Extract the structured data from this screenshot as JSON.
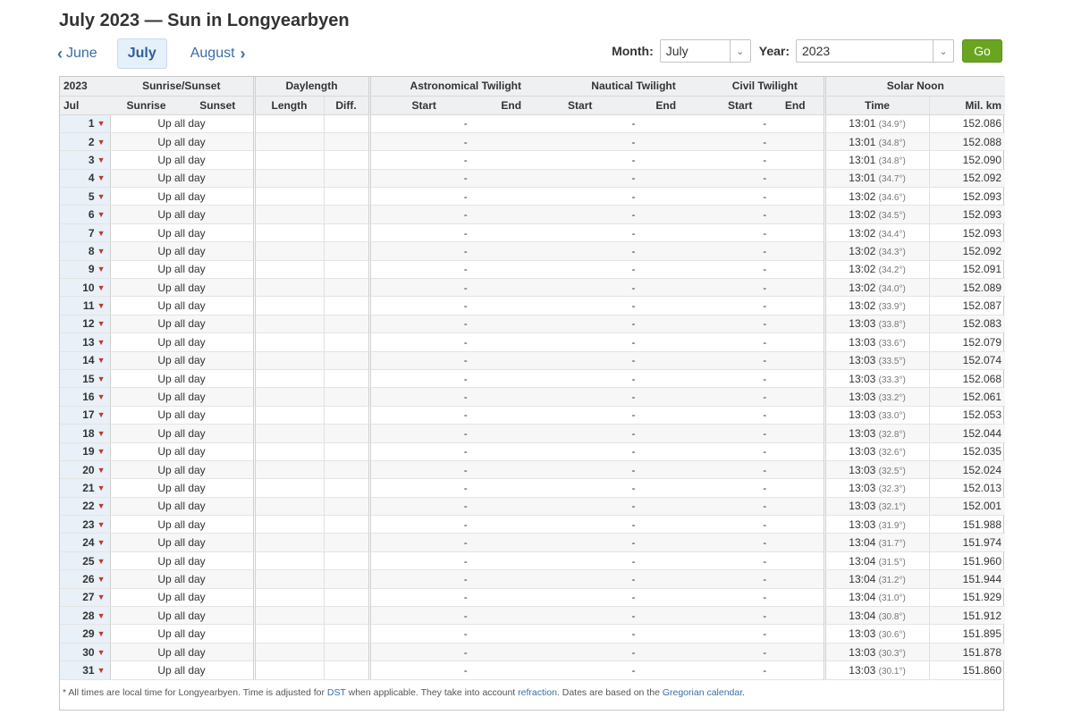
{
  "title": "July 2023 — Sun in Longyearbyen",
  "nav": {
    "prev": "June",
    "current": "July",
    "next": "August"
  },
  "picker": {
    "month_label": "Month:",
    "month_value": "July",
    "year_label": "Year:",
    "year_value": "2023",
    "go_label": "Go"
  },
  "table": {
    "groups": {
      "year": "2023",
      "sunrise_sunset": "Sunrise/Sunset",
      "daylength": "Daylength",
      "astro": "Astronomical Twilight",
      "nautical": "Nautical Twilight",
      "civil": "Civil Twilight",
      "noon": "Solar Noon"
    },
    "cols": {
      "month": "Jul",
      "sunrise": "Sunrise",
      "sunset": "Sunset",
      "length": "Length",
      "diff": "Diff.",
      "astro_start": "Start",
      "astro_end": "End",
      "naut_start": "Start",
      "naut_end": "End",
      "civil_start": "Start",
      "civil_end": "End",
      "time": "Time",
      "km": "Mil. km"
    },
    "rows": [
      {
        "day": "1",
        "status": "Up all day",
        "astro": "-",
        "naut": "-",
        "civil": "-",
        "time": "13:01",
        "angle": "(34.9°)",
        "km": "152.086"
      },
      {
        "day": "2",
        "status": "Up all day",
        "astro": "-",
        "naut": "-",
        "civil": "-",
        "time": "13:01",
        "angle": "(34.8°)",
        "km": "152.088"
      },
      {
        "day": "3",
        "status": "Up all day",
        "astro": "-",
        "naut": "-",
        "civil": "-",
        "time": "13:01",
        "angle": "(34.8°)",
        "km": "152.090"
      },
      {
        "day": "4",
        "status": "Up all day",
        "astro": "-",
        "naut": "-",
        "civil": "-",
        "time": "13:01",
        "angle": "(34.7°)",
        "km": "152.092"
      },
      {
        "day": "5",
        "status": "Up all day",
        "astro": "-",
        "naut": "-",
        "civil": "-",
        "time": "13:02",
        "angle": "(34.6°)",
        "km": "152.093"
      },
      {
        "day": "6",
        "status": "Up all day",
        "astro": "-",
        "naut": "-",
        "civil": "-",
        "time": "13:02",
        "angle": "(34.5°)",
        "km": "152.093"
      },
      {
        "day": "7",
        "status": "Up all day",
        "astro": "-",
        "naut": "-",
        "civil": "-",
        "time": "13:02",
        "angle": "(34.4°)",
        "km": "152.093"
      },
      {
        "day": "8",
        "status": "Up all day",
        "astro": "-",
        "naut": "-",
        "civil": "-",
        "time": "13:02",
        "angle": "(34.3°)",
        "km": "152.092"
      },
      {
        "day": "9",
        "status": "Up all day",
        "astro": "-",
        "naut": "-",
        "civil": "-",
        "time": "13:02",
        "angle": "(34.2°)",
        "km": "152.091"
      },
      {
        "day": "10",
        "status": "Up all day",
        "astro": "-",
        "naut": "-",
        "civil": "-",
        "time": "13:02",
        "angle": "(34.0°)",
        "km": "152.089"
      },
      {
        "day": "11",
        "status": "Up all day",
        "astro": "-",
        "naut": "-",
        "civil": "-",
        "time": "13:02",
        "angle": "(33.9°)",
        "km": "152.087"
      },
      {
        "day": "12",
        "status": "Up all day",
        "astro": "-",
        "naut": "-",
        "civil": "-",
        "time": "13:03",
        "angle": "(33.8°)",
        "km": "152.083"
      },
      {
        "day": "13",
        "status": "Up all day",
        "astro": "-",
        "naut": "-",
        "civil": "-",
        "time": "13:03",
        "angle": "(33.6°)",
        "km": "152.079"
      },
      {
        "day": "14",
        "status": "Up all day",
        "astro": "-",
        "naut": "-",
        "civil": "-",
        "time": "13:03",
        "angle": "(33.5°)",
        "km": "152.074"
      },
      {
        "day": "15",
        "status": "Up all day",
        "astro": "-",
        "naut": "-",
        "civil": "-",
        "time": "13:03",
        "angle": "(33.3°)",
        "km": "152.068"
      },
      {
        "day": "16",
        "status": "Up all day",
        "astro": "-",
        "naut": "-",
        "civil": "-",
        "time": "13:03",
        "angle": "(33.2°)",
        "km": "152.061"
      },
      {
        "day": "17",
        "status": "Up all day",
        "astro": "-",
        "naut": "-",
        "civil": "-",
        "time": "13:03",
        "angle": "(33.0°)",
        "km": "152.053"
      },
      {
        "day": "18",
        "status": "Up all day",
        "astro": "-",
        "naut": "-",
        "civil": "-",
        "time": "13:03",
        "angle": "(32.8°)",
        "km": "152.044"
      },
      {
        "day": "19",
        "status": "Up all day",
        "astro": "-",
        "naut": "-",
        "civil": "-",
        "time": "13:03",
        "angle": "(32.6°)",
        "km": "152.035"
      },
      {
        "day": "20",
        "status": "Up all day",
        "astro": "-",
        "naut": "-",
        "civil": "-",
        "time": "13:03",
        "angle": "(32.5°)",
        "km": "152.024"
      },
      {
        "day": "21",
        "status": "Up all day",
        "astro": "-",
        "naut": "-",
        "civil": "-",
        "time": "13:03",
        "angle": "(32.3°)",
        "km": "152.013"
      },
      {
        "day": "22",
        "status": "Up all day",
        "astro": "-",
        "naut": "-",
        "civil": "-",
        "time": "13:03",
        "angle": "(32.1°)",
        "km": "152.001"
      },
      {
        "day": "23",
        "status": "Up all day",
        "astro": "-",
        "naut": "-",
        "civil": "-",
        "time": "13:03",
        "angle": "(31.9°)",
        "km": "151.988"
      },
      {
        "day": "24",
        "status": "Up all day",
        "astro": "-",
        "naut": "-",
        "civil": "-",
        "time": "13:04",
        "angle": "(31.7°)",
        "km": "151.974"
      },
      {
        "day": "25",
        "status": "Up all day",
        "astro": "-",
        "naut": "-",
        "civil": "-",
        "time": "13:04",
        "angle": "(31.5°)",
        "km": "151.960"
      },
      {
        "day": "26",
        "status": "Up all day",
        "astro": "-",
        "naut": "-",
        "civil": "-",
        "time": "13:04",
        "angle": "(31.2°)",
        "km": "151.944"
      },
      {
        "day": "27",
        "status": "Up all day",
        "astro": "-",
        "naut": "-",
        "civil": "-",
        "time": "13:04",
        "angle": "(31.0°)",
        "km": "151.929"
      },
      {
        "day": "28",
        "status": "Up all day",
        "astro": "-",
        "naut": "-",
        "civil": "-",
        "time": "13:04",
        "angle": "(30.8°)",
        "km": "151.912"
      },
      {
        "day": "29",
        "status": "Up all day",
        "astro": "-",
        "naut": "-",
        "civil": "-",
        "time": "13:03",
        "angle": "(30.6°)",
        "km": "151.895"
      },
      {
        "day": "30",
        "status": "Up all day",
        "astro": "-",
        "naut": "-",
        "civil": "-",
        "time": "13:03",
        "angle": "(30.3°)",
        "km": "151.878"
      },
      {
        "day": "31",
        "status": "Up all day",
        "astro": "-",
        "naut": "-",
        "civil": "-",
        "time": "13:03",
        "angle": "(30.1°)",
        "km": "151.860"
      }
    ]
  },
  "footnote": {
    "part1": "* All times are local time for Longyearbyen. Time is adjusted for ",
    "dst": "DST",
    "part2": " when applicable. They take into account ",
    "refraction": "refraction",
    "part3": ". Dates are based on the ",
    "gregorian": "Gregorian calendar",
    "part4": "."
  },
  "icons": {
    "prev": "chevron-left-icon",
    "next": "chevron-right-icon",
    "dropdown": "chevron-down-icon",
    "day_expand": "chevron-down-icon"
  },
  "colors": {
    "link": "#3b6ea5",
    "go_button": "#6aa51f",
    "day_chevron": "#c0392b",
    "current_month_bg": "#e6f0fa"
  }
}
